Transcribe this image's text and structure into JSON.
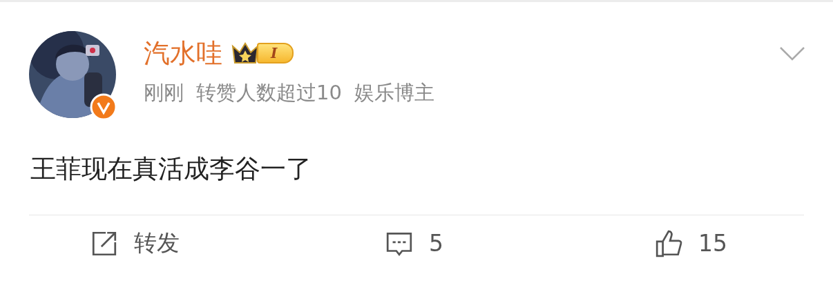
{
  "post": {
    "author": {
      "name": "汽水哇",
      "level_badge": "I",
      "verified": true
    },
    "meta": [
      {
        "text": "刚刚"
      },
      {
        "text": "转赞人数超过10"
      },
      {
        "text": "娱乐博主"
      }
    ],
    "text": "王菲现在真活成李谷一了",
    "actions": [
      {
        "kind": "repost",
        "label": "转发"
      },
      {
        "kind": "comment",
        "label": "5"
      },
      {
        "kind": "like",
        "label": "15"
      }
    ]
  }
}
